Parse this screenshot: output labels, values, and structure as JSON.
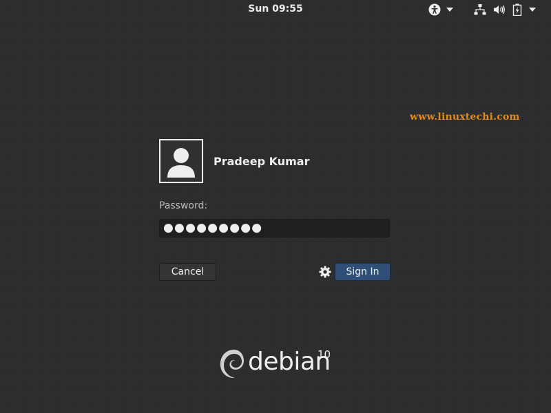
{
  "topbar": {
    "clock": "Sun 09:55",
    "icons": [
      "accessibility-icon",
      "chevron-down-icon",
      "network-icon",
      "volume-icon",
      "battery-icon",
      "chevron-down-icon"
    ]
  },
  "watermark": "www.linuxtechi.com",
  "login": {
    "username": "Pradeep Kumar",
    "password_label": "Password:",
    "password_masked": "●●●●●●●●●",
    "cancel_label": "Cancel",
    "signin_label": "Sign In",
    "settings_icon": "gear-icon"
  },
  "branding": {
    "distro": "debian",
    "version": "10"
  },
  "colors": {
    "background": "#2b2c2e",
    "accent": "#2f4f76",
    "watermark": "#e08a1e",
    "text": "#eeeeec"
  }
}
